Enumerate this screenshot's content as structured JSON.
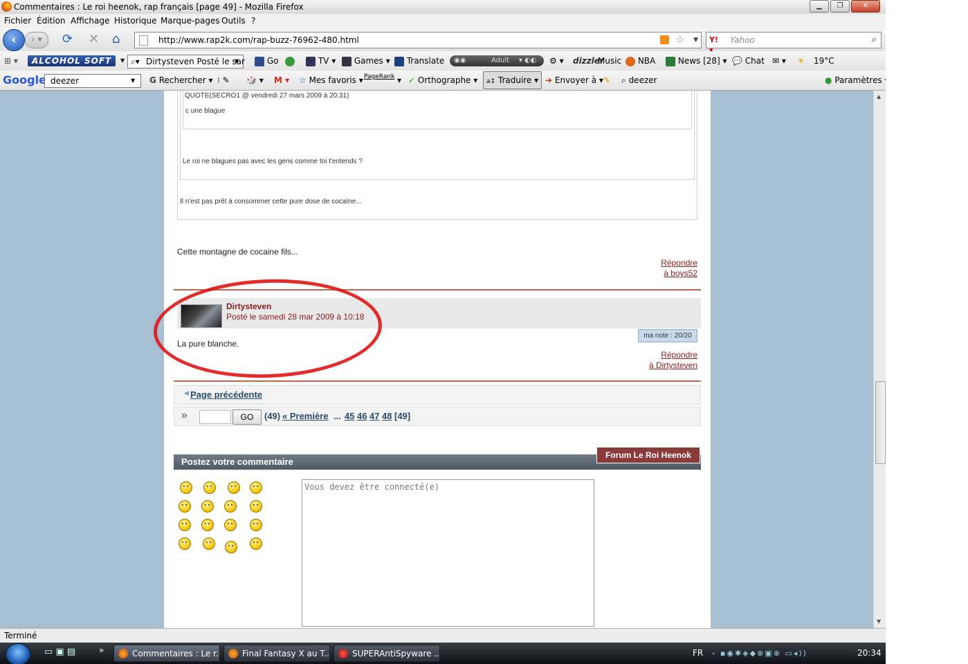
{
  "window": {
    "title": "Commentaires : Le roi heenok, rap français  [page 49] - Mozilla Firefox"
  },
  "menu": [
    "Fichier",
    "Édition",
    "Affichage",
    "Historique",
    "Marque-pages",
    "Outils",
    "?"
  ],
  "nav": {
    "url": "http://www.rap2k.com/rap-buzz-76962-480.html",
    "search_placeholder": "Yahoo"
  },
  "toolbar1": {
    "alcohol": "ALCOHOL SOFT",
    "search_box": "Dirtysteven Posté le sar",
    "go": "Go",
    "tv": "TV",
    "games": "Games",
    "translate": "Translate",
    "adult": "Adult",
    "dizzler": "dizzler",
    "music": "Music",
    "nba": "NBA",
    "news": "News [28]",
    "chat": "Chat",
    "weather": "19°C"
  },
  "toolbar2": {
    "google": "Google",
    "query": "deezer",
    "rechercher": "Rechercher",
    "favoris": "Mes favoris",
    "pagerank": "PageRank",
    "orthographe": "Orthographe",
    "traduire": "Traduire",
    "envoyer": "Envoyer à",
    "deezer": "deezer",
    "parametres": "Paramètres"
  },
  "content": {
    "quote_header": "QUOTE(SECRO1 @ vendredi 27 mars 2009 à 20:31)",
    "quote_inner": "c une blague",
    "quote_mid": "Le roi ne blagues pas avec les gens comme toi t'entends ?",
    "quote_outer": "Il n'est pas prêt à consommer cette pure dose de cocaïne...",
    "post1_text": "Cette montagne de cocaine fils...",
    "reply1_line1": "Répondre",
    "reply1_line2": "à boys52",
    "comment": {
      "author": "Dirtysteven",
      "posted": "Posté le samedi 28 mar 2009 à 10:18",
      "note": "ma note : 20/20",
      "text": "La pure blanche.",
      "reply_line1": "Répondre",
      "reply_line2": "à Dirtysteven"
    },
    "pagination": {
      "prev": "Page précédente",
      "go": "GO",
      "count": "(49)",
      "first": "« Première",
      "ellipsis": "...",
      "pages": [
        "45",
        "46",
        "47",
        "48"
      ],
      "current": "[49]"
    },
    "post_title": "Postez votre commentaire",
    "forum_button": "Forum Le Roi Heenok",
    "textarea_placeholder": "Vous devez être connecté(e)"
  },
  "status": "Terminé",
  "taskbar": {
    "tasks": [
      "Commentaires : Le r...",
      "Final Fantasy X au T...",
      "SUPERAntiSpyware ..."
    ],
    "lang": "FR",
    "clock": "20:34"
  }
}
